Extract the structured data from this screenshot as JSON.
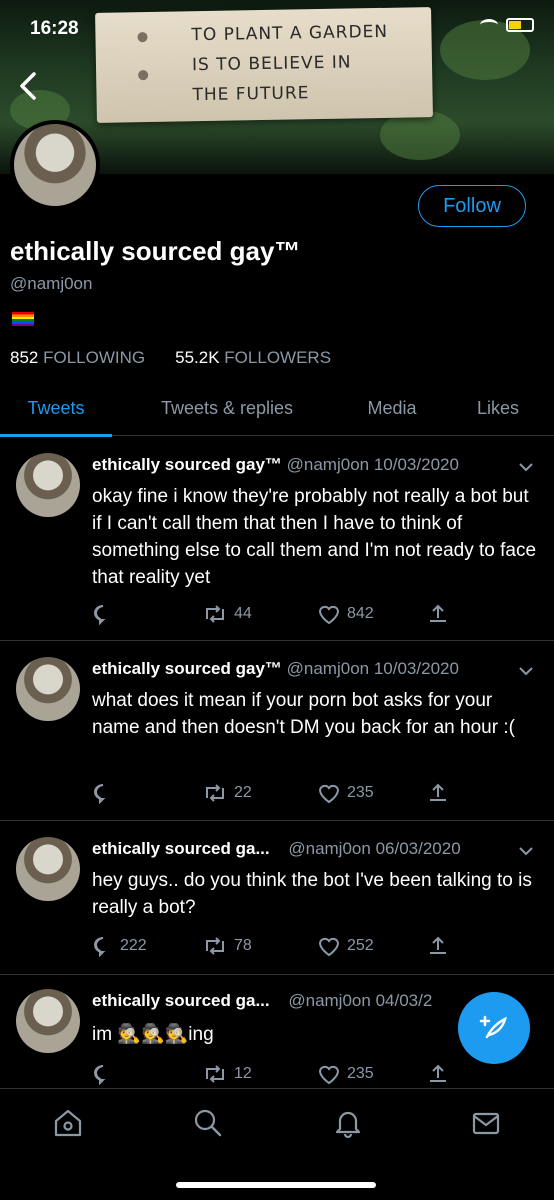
{
  "status_bar": {
    "time": "16:28"
  },
  "banner": {
    "sign_lines": [
      "TO PLANT A GARDEN",
      "IS TO BELIEVE IN",
      "THE FUTURE"
    ]
  },
  "profile": {
    "follow_label": "Follow",
    "display_name": "ethically sourced gay™",
    "handle": "@namj0on",
    "bio_emoji": "rainbow-flag",
    "following_count": "852",
    "following_label": "FOLLOWING",
    "followers_count": "55.2K",
    "followers_label": "FOLLOWERS"
  },
  "tabs": [
    {
      "label": "Tweets",
      "active": true
    },
    {
      "label": "Tweets & replies",
      "active": false
    },
    {
      "label": "Media",
      "active": false
    },
    {
      "label": "Likes",
      "active": false
    }
  ],
  "tweets": [
    {
      "name": "ethically sourced gay™",
      "handle": "@namj0on",
      "date": "10/03/2020",
      "text": "okay fine i know they're probably not really a bot but if I can't call them that then I have to think of something else to call them and I'm not ready to face that reality yet",
      "replies": "",
      "retweets": "44",
      "likes": "842"
    },
    {
      "name": "ethically sourced gay™",
      "handle": "@namj0on",
      "date": "10/03/2020",
      "text": "what does it mean if your porn bot asks for your name and then doesn't DM you back for an hour :(",
      "replies": "",
      "retweets": "22",
      "likes": "235"
    },
    {
      "name": "ethically sourced ga...",
      "handle": "@namj0on",
      "date": "06/03/2020",
      "text": "hey guys..  do you think the bot I've been talking to is really a bot?",
      "replies": "222",
      "retweets": "78",
      "likes": "252"
    },
    {
      "name": "ethically sourced ga...",
      "handle": "@namj0on",
      "date": "04/03/2",
      "text": "im 🕵🕵🕵ing",
      "replies": "",
      "retweets": "12",
      "likes": "235"
    }
  ],
  "colors": {
    "accent": "#1d9bf0",
    "muted": "#8b98a5",
    "divider": "#2f3336"
  }
}
